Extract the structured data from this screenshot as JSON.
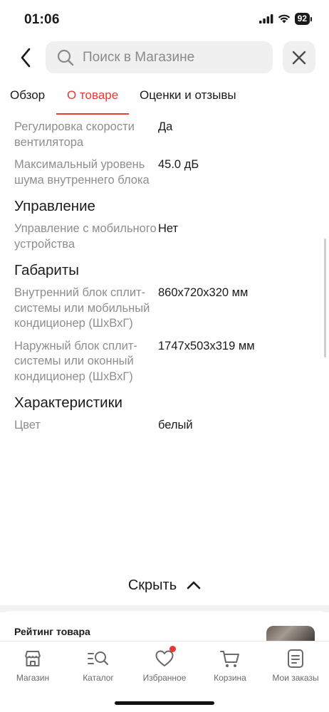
{
  "status_bar": {
    "time": "01:06",
    "battery": "92"
  },
  "search": {
    "placeholder": "Поиск в Магазине",
    "value": ""
  },
  "tabs": [
    {
      "label": "Обзор",
      "active": false
    },
    {
      "label": "О товаре",
      "active": true
    },
    {
      "label": "Оценки и отзывы",
      "active": false
    }
  ],
  "specs": {
    "fan_speed": {
      "label": "Регулировка скорости вентилятора",
      "value": "Да"
    },
    "noise": {
      "label": "Максимальный уровень шума внутреннего блока",
      "value": "45.0 дБ"
    },
    "control_title": "Управление",
    "mobile_control": {
      "label": "Управление с мобильного устройства",
      "value": "Нет"
    },
    "dims_title": "Габариты",
    "indoor_unit": {
      "label": "Внутренний блок сплит-системы или мобильный кондиционер (ШхВхГ)",
      "value": "860x720x320 мм"
    },
    "outdoor_unit": {
      "label": "Наружный блок сплит-системы или оконный кондиционер (ШхВхГ)",
      "value": "1747x503x319 мм"
    },
    "chars_title": "Характеристики",
    "color": {
      "label": "Цвет",
      "value": "белый"
    }
  },
  "collapse_label": "Скрыть",
  "rating_title": "Рейтинг товара",
  "bottom_nav": [
    {
      "label": "Магазин",
      "icon": "store-icon"
    },
    {
      "label": "Каталог",
      "icon": "catalog-search-icon"
    },
    {
      "label": "Избранное",
      "icon": "heart-icon"
    },
    {
      "label": "Корзина",
      "icon": "cart-icon"
    },
    {
      "label": "Мои заказы",
      "icon": "orders-icon"
    }
  ],
  "colors": {
    "accent": "#e53a30",
    "label_gray": "#8e8e8e",
    "text": "#1a1a1a"
  }
}
